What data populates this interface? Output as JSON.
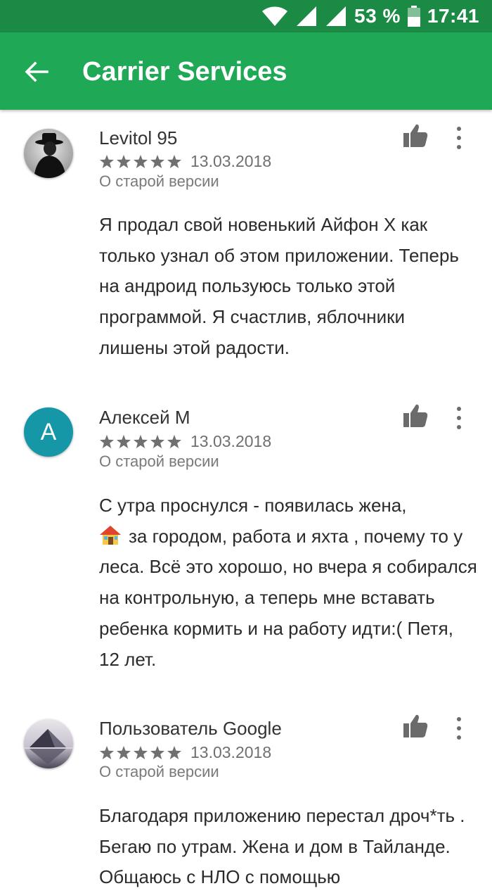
{
  "status_bar": {
    "battery": "53 %",
    "time": "17:41",
    "icons": [
      "wifi-icon",
      "signal-icon",
      "signal-icon",
      "battery-icon"
    ]
  },
  "app_bar": {
    "back_icon": "arrow-back-icon",
    "title": "Carrier Services",
    "color": "#1fa855"
  },
  "reviews": [
    {
      "author": "Levitol 95",
      "avatar": "photo-man-in-hat",
      "rating": 5,
      "date": "13.03.2018",
      "version_note": "О старой версии",
      "text": "Я продал свой новенький Айфон Х как только узнал об этом приложении. Теперь на андроид пользуюсь только этой программой. Я счастлив, яблочники лишены этой радости."
    },
    {
      "author": "Алексей М",
      "avatar_letter": "А",
      "avatar_color": "#1597a8",
      "rating": 5,
      "date": "13.03.2018",
      "version_note": "О старой версии",
      "emoji": "house-emoji",
      "text": "С утра проснулся - появилась жена, \n за городом, работа и яхта , почему то у леса. Всё это хорошо, но вчера я собирался на контрольную, а теперь мне вставать ребенка кормить и на работу идти:( Петя, 12 лет.",
      "text_line1": "С утра проснулся - появилась жена,",
      "text_rest": "за городом, работа и яхта , почему то у леса. Всё это хорошо, но вчера я собирался на контрольную, а теперь мне вставать ребенка кормить и на работу идти:( Петя, 12 лет."
    },
    {
      "author": "Пользователь Google",
      "avatar": "photo-pyramid",
      "rating": 5,
      "date": "13.03.2018",
      "version_note": "О старой версии",
      "text": "Благодаря приложению перестал дроч*ть . Бегаю по утрам. Жена и дом в Тайланде. Общаюсь с НЛО с помощью"
    }
  ]
}
